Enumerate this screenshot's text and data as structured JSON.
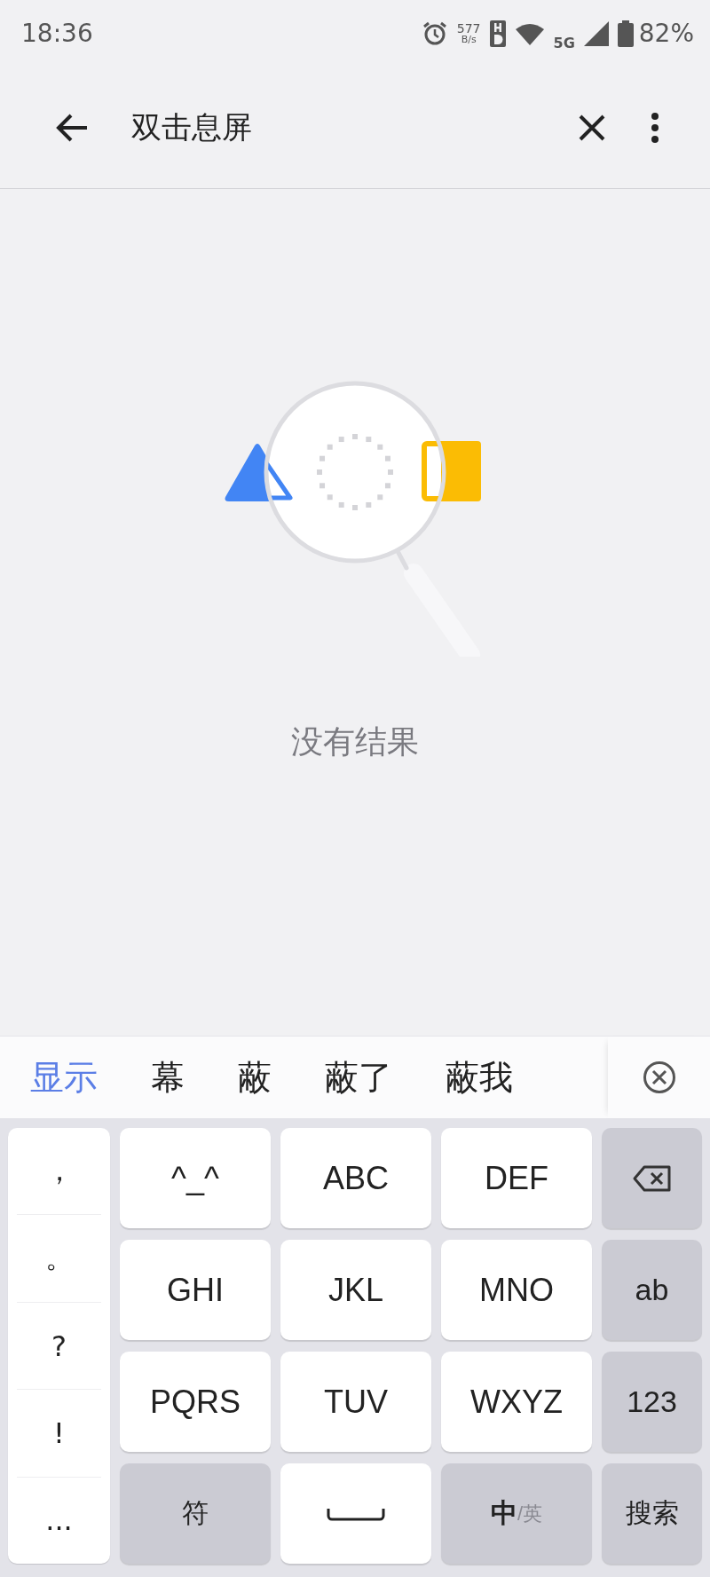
{
  "status_bar": {
    "time": "18:36",
    "speed_value": "577",
    "speed_unit": "B/s",
    "network": "5G",
    "battery": "82%"
  },
  "app_bar": {
    "search_text": "双击息屏"
  },
  "empty_state": {
    "message": "没有结果"
  },
  "candidates": [
    {
      "text": "显示",
      "selected": true
    },
    {
      "text": "幕",
      "selected": false
    },
    {
      "text": "蔽",
      "selected": false
    },
    {
      "text": "蔽了",
      "selected": false
    },
    {
      "text": "蔽我",
      "selected": false
    }
  ],
  "keyboard": {
    "symbols": [
      "，",
      "。",
      "?",
      "!",
      "..."
    ],
    "keys": [
      {
        "kind": "letter",
        "label": "^_^"
      },
      {
        "kind": "letter",
        "label": "ABC"
      },
      {
        "kind": "letter",
        "label": "DEF"
      },
      {
        "kind": "backspace"
      },
      {
        "kind": "letter",
        "label": "GHI"
      },
      {
        "kind": "letter",
        "label": "JKL"
      },
      {
        "kind": "letter",
        "label": "MNO"
      },
      {
        "kind": "function",
        "label": "ab"
      },
      {
        "kind": "letter",
        "label": "PQRS"
      },
      {
        "kind": "letter",
        "label": "TUV"
      },
      {
        "kind": "letter",
        "label": "WXYZ"
      },
      {
        "kind": "function",
        "label": "123"
      },
      {
        "kind": "function",
        "label": "符"
      },
      {
        "kind": "space"
      },
      {
        "kind": "language",
        "label": "中",
        "secondary": "/英"
      },
      {
        "kind": "function",
        "label": "搜索"
      }
    ]
  }
}
